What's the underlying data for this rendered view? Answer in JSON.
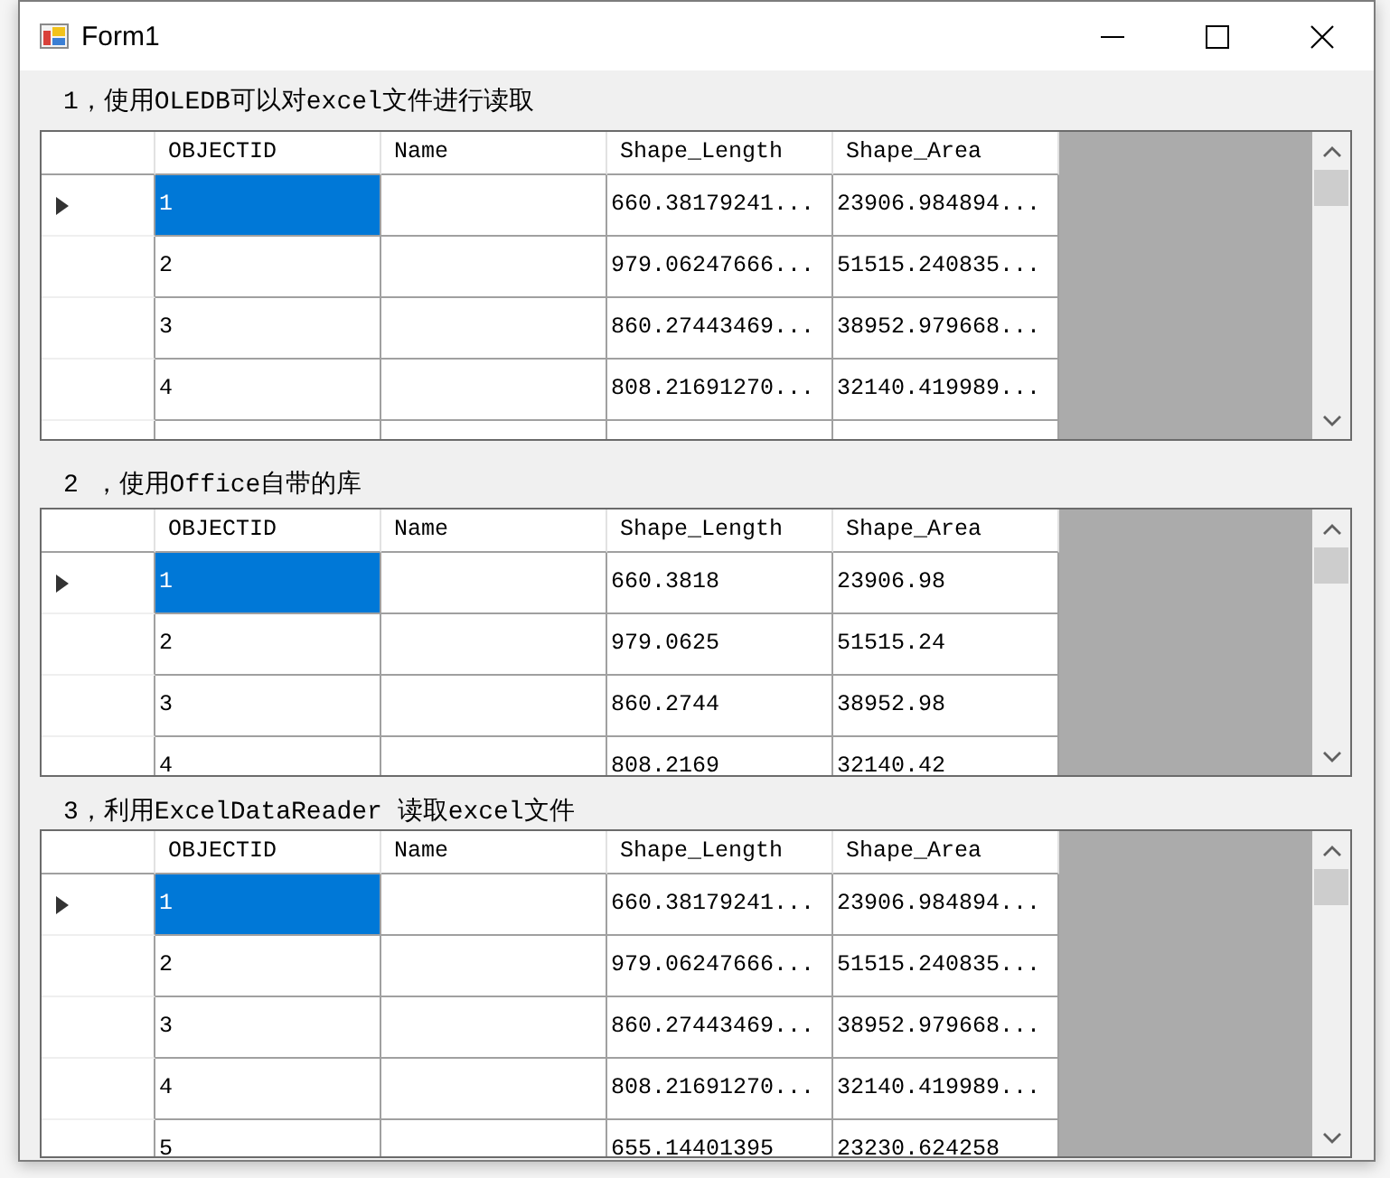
{
  "window": {
    "title": "Form1"
  },
  "sections": [
    {
      "label": "1，使用OLEDB可以对excel文件进行读取",
      "grid": {
        "columns": [
          "OBJECTID",
          "Name",
          "Shape_Length",
          "Shape_Area"
        ],
        "rows": [
          {
            "selected": true,
            "objectid": "1",
            "shape_length": "660.38179241...",
            "shape_area": "23906.984894..."
          },
          {
            "selected": false,
            "objectid": "2",
            "shape_length": "979.06247666...",
            "shape_area": "51515.240835..."
          },
          {
            "selected": false,
            "objectid": "3",
            "shape_length": "860.27443469...",
            "shape_area": "38952.979668..."
          },
          {
            "selected": false,
            "objectid": "4",
            "shape_length": "808.21691270...",
            "shape_area": "32140.419989..."
          }
        ]
      }
    },
    {
      "label": "2 ，使用Office自带的库",
      "grid": {
        "columns": [
          "OBJECTID",
          "Name",
          "Shape_Length",
          "Shape_Area"
        ],
        "rows": [
          {
            "selected": true,
            "objectid": "1",
            "shape_length": "660.3818",
            "shape_area": "23906.98"
          },
          {
            "selected": false,
            "objectid": "2",
            "shape_length": "979.0625",
            "shape_area": "51515.24"
          },
          {
            "selected": false,
            "objectid": "3",
            "shape_length": "860.2744",
            "shape_area": "38952.98"
          },
          {
            "selected": false,
            "objectid": "4",
            "shape_length": "808.2169",
            "shape_area": "32140.42"
          }
        ]
      }
    },
    {
      "label": "3，利用ExcelDataReader 读取excel文件",
      "grid": {
        "columns": [
          "OBJECTID",
          "Name",
          "Shape_Length",
          "Shape_Area"
        ],
        "rows": [
          {
            "selected": true,
            "objectid": "1",
            "shape_length": "660.38179241...",
            "shape_area": "23906.984894..."
          },
          {
            "selected": false,
            "objectid": "2",
            "shape_length": "979.06247666...",
            "shape_area": "51515.240835..."
          },
          {
            "selected": false,
            "objectid": "3",
            "shape_length": "860.27443469...",
            "shape_area": "38952.979668..."
          },
          {
            "selected": false,
            "objectid": "4",
            "shape_length": "808.21691270...",
            "shape_area": "32140.419989..."
          },
          {
            "selected": false,
            "objectid": "5",
            "shape_length": "655.14401395",
            "shape_area": "23230.624258"
          }
        ]
      }
    }
  ]
}
